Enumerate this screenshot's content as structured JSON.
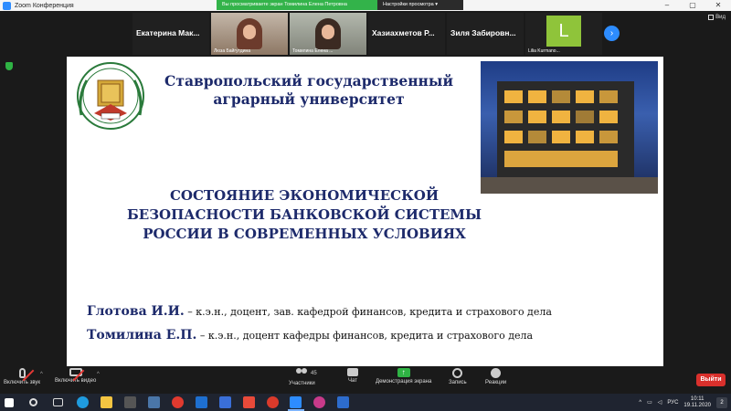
{
  "window": {
    "title": "Zoom Конференция",
    "minimize": "–",
    "maximize": "▢",
    "close": "✕"
  },
  "share_banner": {
    "viewing_text": "Вы просматриваете экран Томилина Елена Петровна",
    "view_options": "Настройки просмотра ▾"
  },
  "participants_strip": [
    {
      "name": "Екатерина Мак...",
      "caption": ""
    },
    {
      "name": "",
      "caption": "Люза Байгутдина"
    },
    {
      "name": "",
      "caption": "Томилина Елена ..."
    },
    {
      "name": "Хазиахметов  Р...",
      "caption": ""
    },
    {
      "name": "Зиля Забировн...",
      "caption": ""
    },
    {
      "name": "",
      "caption": "Lilia Kurmano...",
      "avatar_letter": "L"
    }
  ],
  "view_button": "Вид",
  "slide": {
    "university_name_line1": "Ставропольский государственный",
    "university_name_line2": "аграрный университет",
    "title_line1": "СОСТОЯНИЕ ЭКОНОМИЧЕСКОЙ",
    "title_line2": "БЕЗОПАСНОСТИ БАНКОВСКОЙ СИСТЕМЫ",
    "title_line3": "РОССИИ В СОВРЕМЕННЫХ УСЛОВИЯХ",
    "author1_name": "Глотова И.И.",
    "author1_desc": " – к.э.н., доцент, зав. кафедрой финансов, кредита и страхового дела",
    "author2_name": "Томилина Е.П.",
    "author2_desc": " – к.э.н., доцент кафедры финансов, кредита и страхового дела",
    "emblem_text": "СТАВРОПОЛЬСКИЙ ГОСУДАРСТВЕННЫЙ АГРАРНЫЙ УНИВЕРСИТЕТ",
    "emblem_year": "1930"
  },
  "controls": {
    "unmute": "Включить звук",
    "start_video": "Включить видео",
    "participants": "Участники",
    "participants_count": "45",
    "chat": "Чат",
    "share_screen": "Демонстрация экрана",
    "record": "Запись",
    "reactions": "Реакции",
    "leave": "Выйти"
  },
  "taskbar": {
    "language": "РУС",
    "time": "10:11",
    "date": "19.11.2020",
    "notifications": "2"
  },
  "colors": {
    "zoom_blue": "#2d8cff",
    "share_green": "#33b34a",
    "leave_red": "#d9302c",
    "slide_title_navy": "#1d2a6b"
  }
}
